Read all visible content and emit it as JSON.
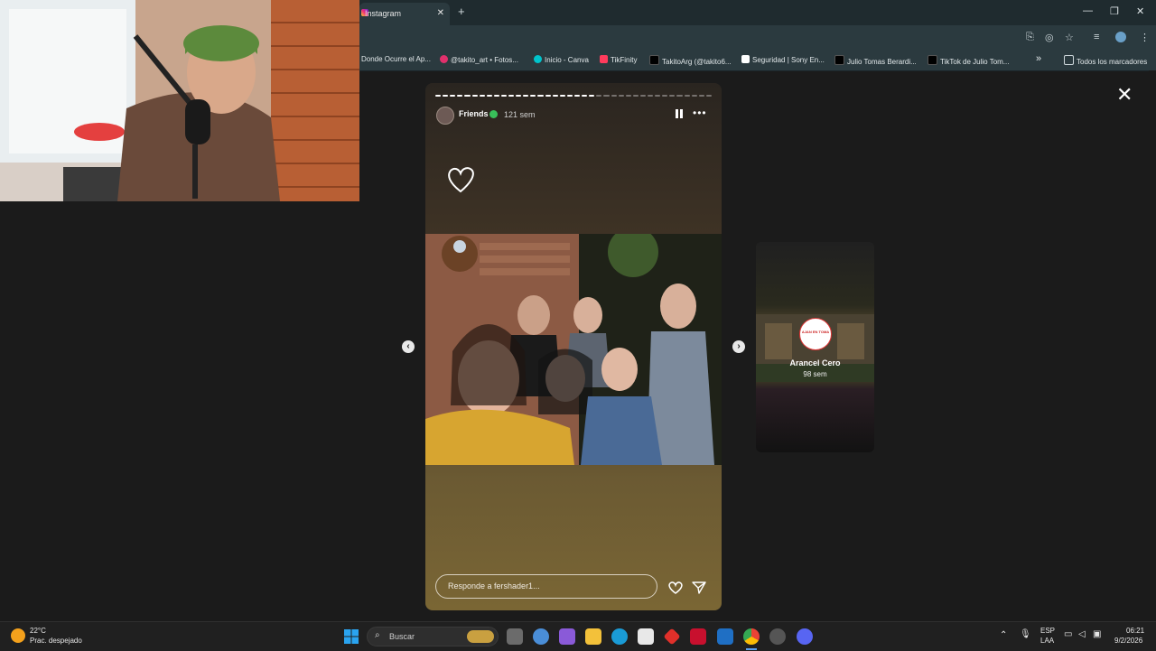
{
  "browser": {
    "tab_title": "Instagram",
    "tab_close": "✕",
    "new_tab": "+",
    "window_controls": {
      "minimize": "—",
      "maximize": "❐",
      "close": "✕"
    },
    "bookmarks": [
      {
        "label": "Donde Ocurre el Ap...",
        "color": "#3a7bd5"
      },
      {
        "label": "@takito_art • Fotos...",
        "color": "#e1306c"
      },
      {
        "label": "Inicio - Canva",
        "color": "#00c4cc"
      },
      {
        "label": "TikFinity",
        "color": "#ff3b5c"
      },
      {
        "label": "TakitoArg (@takito6...",
        "color": "#111111"
      },
      {
        "label": "Seguridad | Sony En...",
        "color": "#222222"
      },
      {
        "label": "Julio Tomas Berardi...",
        "color": "#111111"
      },
      {
        "label": "TikTok de Julio Tom...",
        "color": "#111111"
      }
    ],
    "bookmarks_overflow": "»",
    "all_bookmarks": "Todos los marcadores"
  },
  "story": {
    "username": "Friends",
    "time": "121 sem",
    "more": "•••",
    "reply_placeholder": "Responde a fershader1...",
    "segments_total": 38,
    "segments_viewed": 22
  },
  "next_story": {
    "name": "Arancel Cero",
    "time": "98 sem",
    "badge": "AJAN EN TOMA"
  },
  "overlay": {
    "close": "✕",
    "prev": "‹",
    "next": "›"
  },
  "taskbar": {
    "weather_temp": "22°C",
    "weather_desc": "Prac. despejado",
    "search_placeholder": "Buscar",
    "lang_top": "ESP",
    "lang_bottom": "LAA",
    "time": "06:21",
    "date": "9/2/2026"
  },
  "colors": {
    "accent": "#39c05a",
    "browser_bg": "#2b3a3f",
    "taskbar_bg": "#202020"
  }
}
